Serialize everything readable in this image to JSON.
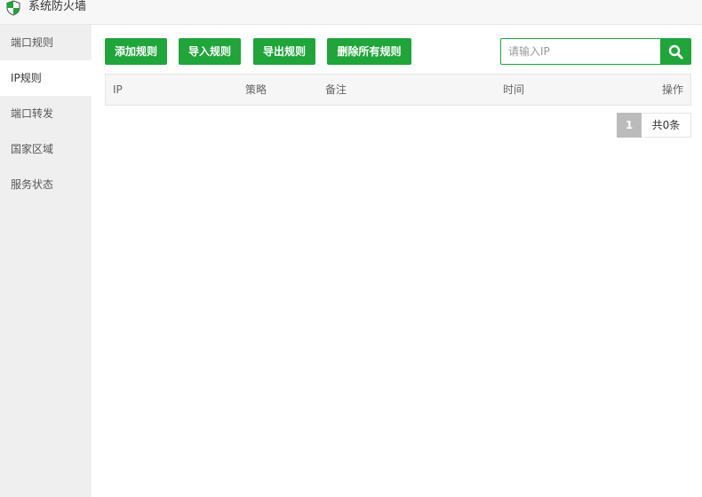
{
  "window": {
    "title": "系统防火墙",
    "logo_icon": "shield-icon"
  },
  "sidebar": {
    "items": [
      {
        "label": "端口规则",
        "active": false
      },
      {
        "label": "IP规则",
        "active": true
      },
      {
        "label": "端口转发",
        "active": false
      },
      {
        "label": "国家区域",
        "active": false
      },
      {
        "label": "服务状态",
        "active": false
      }
    ]
  },
  "toolbar": {
    "add_label": "添加规则",
    "import_label": "导入规则",
    "export_label": "导出规则",
    "delete_all_label": "删除所有规则"
  },
  "search": {
    "placeholder": "请输入IP",
    "value": "",
    "icon": "search-icon"
  },
  "table": {
    "columns": [
      "IP",
      "策略",
      "备注",
      "时间",
      "操作"
    ],
    "rows": []
  },
  "pagination": {
    "current_page": "1",
    "total_label": "共0条"
  },
  "colors": {
    "accent": "#20a53a",
    "sidebar_bg": "#efefef",
    "header_bg": "#f6f6f6"
  }
}
